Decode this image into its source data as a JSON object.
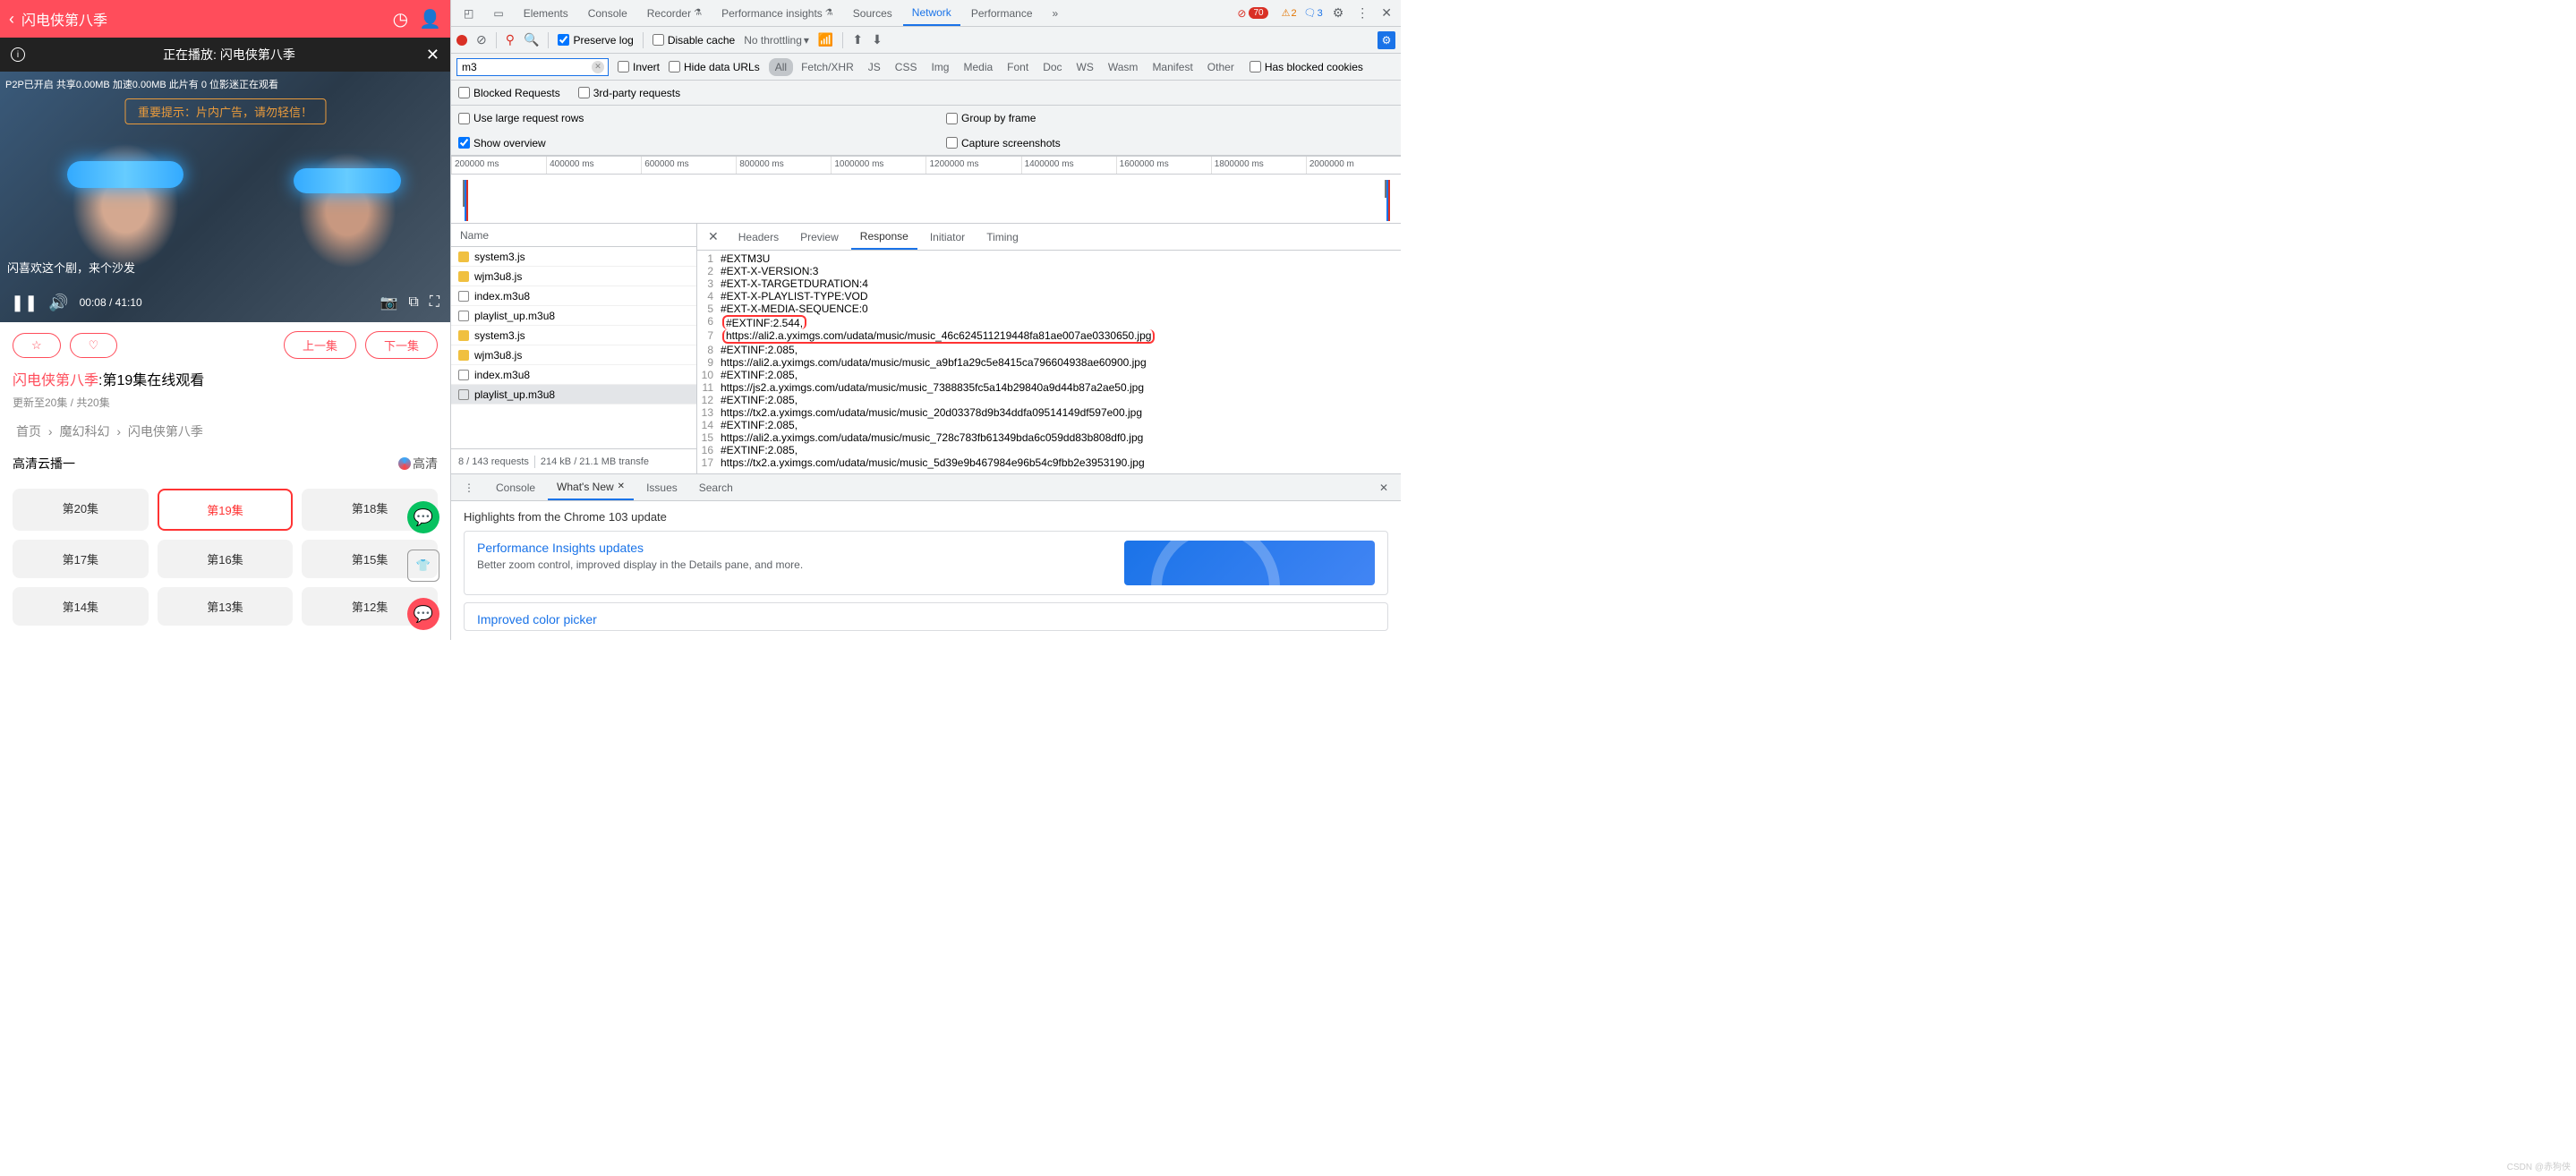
{
  "left": {
    "app_title": "闪电侠第八季",
    "playing_label": "正在播放:  闪电侠第八季",
    "p2p_text": "P2P已开启 共享0.00MB 加速0.00MB 此片有 0 位影迷正在观看",
    "warning_text": "重要提示：片内广告，请勿轻信！",
    "comment_text": "闪喜欢这个剧，来个沙发",
    "time_current": "00:08",
    "time_total": "41:10",
    "prev_ep": "上一集",
    "next_ep": "下一集",
    "title_prefix": "闪电侠第八季",
    "title_suffix": ":第19集在线观看",
    "subtitle": "更新至20集 / 共20集",
    "breadcrumb": [
      "首页",
      "魔幻科幻",
      "闪电侠第八季"
    ],
    "hd_label": "高清云播一",
    "hd_badge": "高清",
    "episodes": [
      "第20集",
      "第19集",
      "第18集",
      "第17集",
      "第16集",
      "第15集",
      "第14集",
      "第13集",
      "第12集"
    ],
    "active_episode_index": 1
  },
  "devtools": {
    "tabs": [
      "Elements",
      "Console",
      "Recorder",
      "Performance insights",
      "Sources",
      "Network",
      "Performance"
    ],
    "active_tab_index": 5,
    "err_count": "70",
    "warn_count": "2",
    "info_count": "3",
    "preserve_log": "Preserve log",
    "disable_cache": "Disable cache",
    "throttling": "No throttling",
    "filter_value": "m3",
    "invert": "Invert",
    "hide_data_urls": "Hide data URLs",
    "types": [
      "All",
      "Fetch/XHR",
      "JS",
      "CSS",
      "Img",
      "Media",
      "Font",
      "Doc",
      "WS",
      "Wasm",
      "Manifest",
      "Other"
    ],
    "blocked_cookies": "Has blocked cookies",
    "blocked_requests": "Blocked Requests",
    "third_party": "3rd-party requests",
    "large_rows": "Use large request rows",
    "group_frame": "Group by frame",
    "show_overview": "Show overview",
    "capture_ss": "Capture screenshots",
    "ruler": [
      "200000 ms",
      "400000 ms",
      "600000 ms",
      "800000 ms",
      "1000000 ms",
      "1200000 ms",
      "1400000 ms",
      "1600000 ms",
      "1800000 ms",
      "2000000 m"
    ],
    "name_col": "Name",
    "requests": [
      {
        "name": "system3.js",
        "icon": "js"
      },
      {
        "name": "wjm3u8.js",
        "icon": "js"
      },
      {
        "name": "index.m3u8",
        "icon": "other"
      },
      {
        "name": "playlist_up.m3u8",
        "icon": "other"
      },
      {
        "name": "system3.js",
        "icon": "js"
      },
      {
        "name": "wjm3u8.js",
        "icon": "js"
      },
      {
        "name": "index.m3u8",
        "icon": "other"
      },
      {
        "name": "playlist_up.m3u8",
        "icon": "other",
        "selected": true
      }
    ],
    "req_summary": "8 / 143 requests",
    "req_transfer": "214 kB / 21.1 MB transfe",
    "resp_tabs": [
      "Headers",
      "Preview",
      "Response",
      "Initiator",
      "Timing"
    ],
    "resp_active": 2,
    "code": [
      "#EXTM3U",
      "#EXT-X-VERSION:3",
      "#EXT-X-TARGETDURATION:4",
      "#EXT-X-PLAYLIST-TYPE:VOD",
      "#EXT-X-MEDIA-SEQUENCE:0",
      "#EXTINF:2.544,",
      "https://ali2.a.yximgs.com/udata/music/music_46c624511219448fa81ae007ae0330650.jpg",
      "#EXTINF:2.085,",
      "https://ali2.a.yximgs.com/udata/music/music_a9bf1a29c5e8415ca796604938ae60900.jpg",
      "#EXTINF:2.085,",
      "https://js2.a.yximgs.com/udata/music/music_7388835fc5a14b29840a9d44b87a2ae50.jpg",
      "#EXTINF:2.085,",
      "https://tx2.a.yximgs.com/udata/music/music_20d03378d9b34ddfa09514149df597e00.jpg",
      "#EXTINF:2.085,",
      "https://ali2.a.yximgs.com/udata/music/music_728c783fb61349bda6c059dd83b808df0.jpg",
      "#EXTINF:2.085,",
      "https://tx2.a.yximgs.com/udata/music/music_5d39e9b467984e96b54c9fbb2e3953190.jpg"
    ],
    "highlighted_line": 6,
    "drawer_tabs": [
      "Console",
      "What's New",
      "Issues",
      "Search"
    ],
    "drawer_active": 1,
    "drawer_heading": "Highlights from the Chrome 103 update",
    "card1_title": "Performance Insights updates",
    "card1_text": "Better zoom control, improved display in the Details pane, and more.",
    "card2_title": "Improved color picker"
  },
  "watermark": "CSDN @赤狗侠"
}
